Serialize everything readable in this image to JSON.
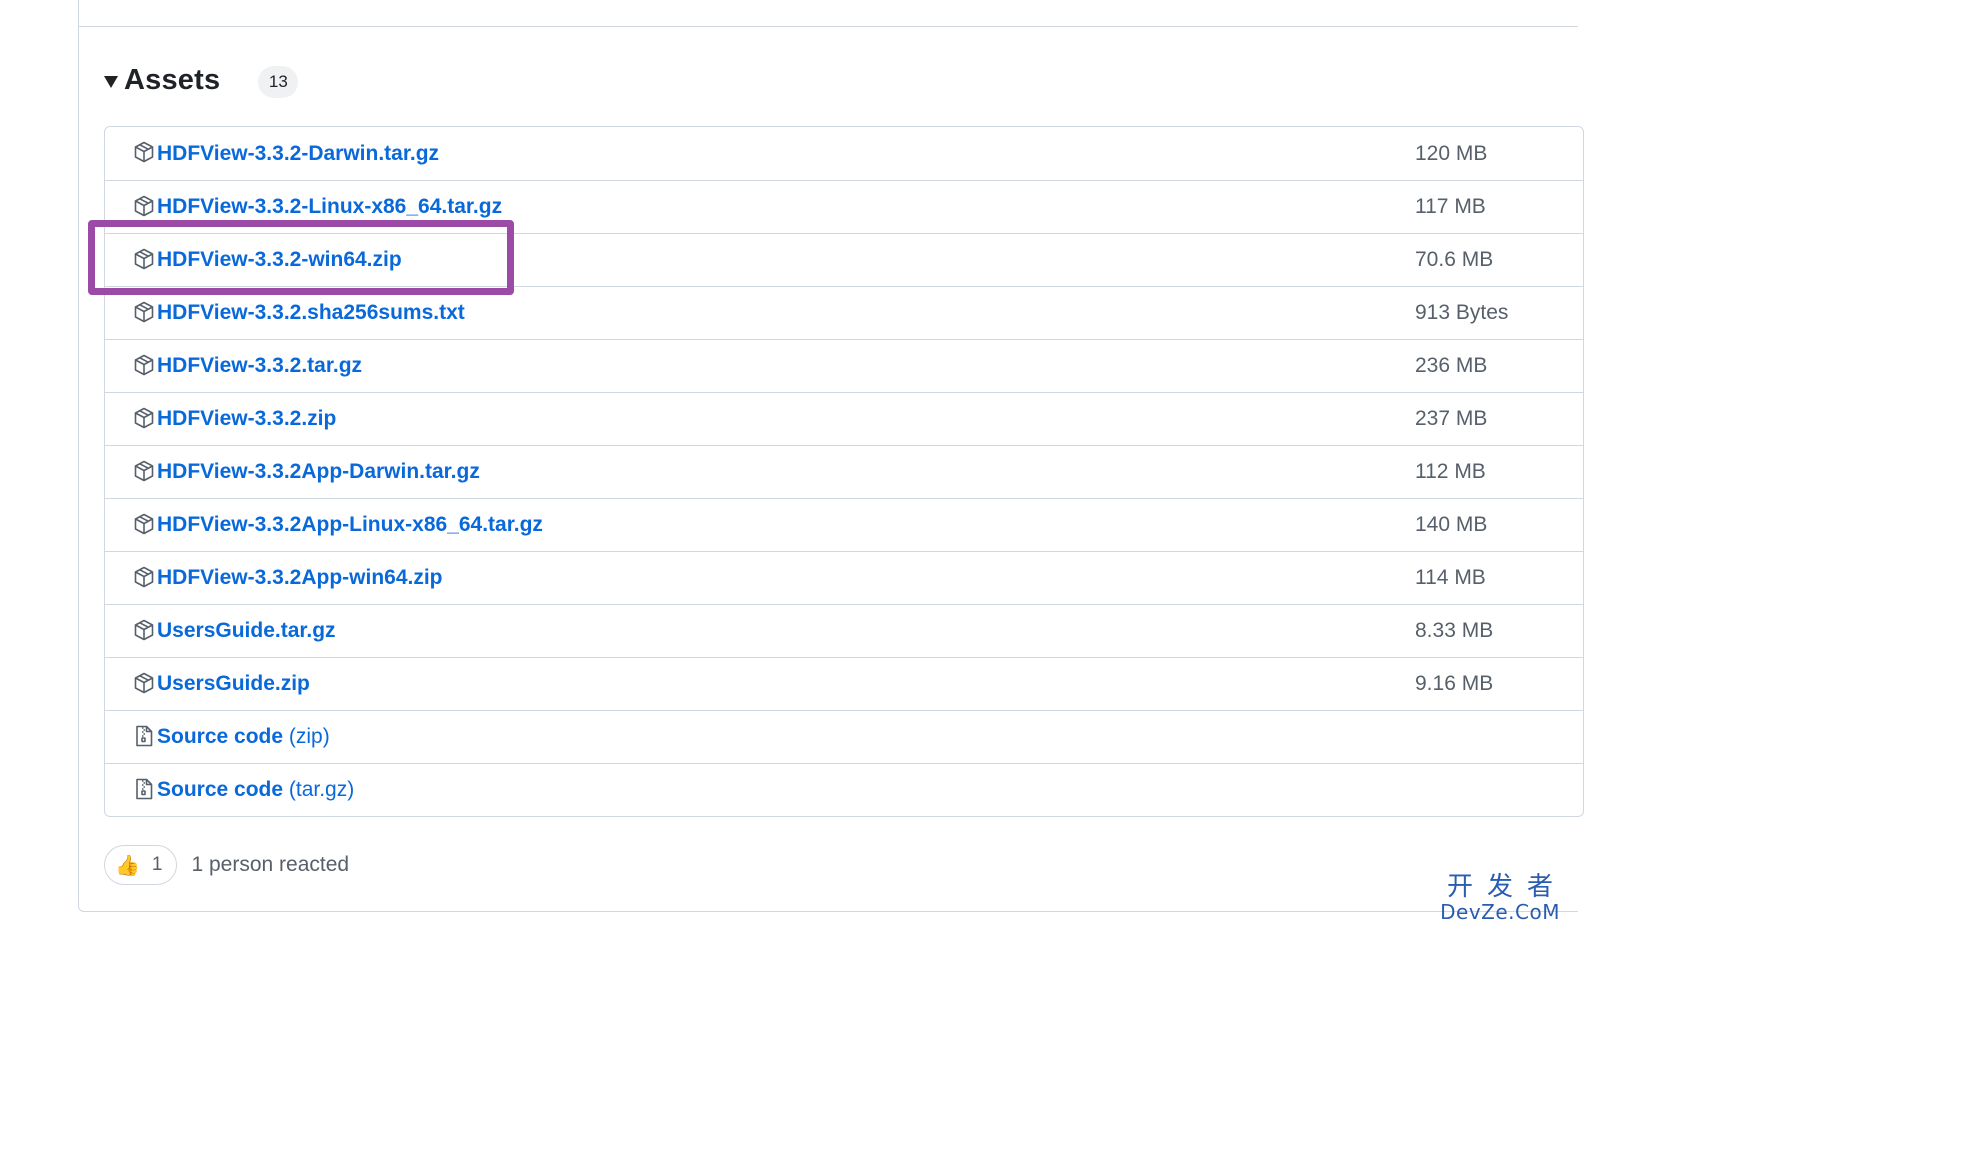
{
  "assets": {
    "title": "Assets",
    "count": "13",
    "items": [
      {
        "name": "HDFView-3.3.2-Darwin.tar.gz",
        "suffix": "",
        "size": "120 MB",
        "icon": "package-icon"
      },
      {
        "name": "HDFView-3.3.2-Linux-x86_64.tar.gz",
        "suffix": "",
        "size": "117 MB",
        "icon": "package-icon"
      },
      {
        "name": "HDFView-3.3.2-win64.zip",
        "suffix": "",
        "size": "70.6 MB",
        "icon": "package-icon"
      },
      {
        "name": "HDFView-3.3.2.sha256sums.txt",
        "suffix": "",
        "size": "913 Bytes",
        "icon": "package-icon"
      },
      {
        "name": "HDFView-3.3.2.tar.gz",
        "suffix": "",
        "size": "236 MB",
        "icon": "package-icon"
      },
      {
        "name": "HDFView-3.3.2.zip",
        "suffix": "",
        "size": "237 MB",
        "icon": "package-icon"
      },
      {
        "name": "HDFView-3.3.2App-Darwin.tar.gz",
        "suffix": "",
        "size": "112 MB",
        "icon": "package-icon"
      },
      {
        "name": "HDFView-3.3.2App-Linux-x86_64.tar.gz",
        "suffix": "",
        "size": "140 MB",
        "icon": "package-icon"
      },
      {
        "name": "HDFView-3.3.2App-win64.zip",
        "suffix": "",
        "size": "114 MB",
        "icon": "package-icon"
      },
      {
        "name": "UsersGuide.tar.gz",
        "suffix": "",
        "size": "8.33 MB",
        "icon": "package-icon"
      },
      {
        "name": "UsersGuide.zip",
        "suffix": "",
        "size": "9.16 MB",
        "icon": "package-icon"
      },
      {
        "name": "Source code",
        "suffix": " (zip)",
        "size": "",
        "icon": "file-zip-icon"
      },
      {
        "name": "Source code",
        "suffix": " (tar.gz)",
        "size": "",
        "icon": "file-zip-icon"
      }
    ]
  },
  "reactions": {
    "emoji": "👍",
    "count": "1",
    "text": "1 person reacted"
  },
  "watermark": {
    "top": "开发者",
    "bottom": "DevZe.CoM"
  },
  "colors": {
    "link": "#0969da",
    "highlight": "#9b4aa5",
    "border": "#d0d7de",
    "muted": "#57606a"
  }
}
